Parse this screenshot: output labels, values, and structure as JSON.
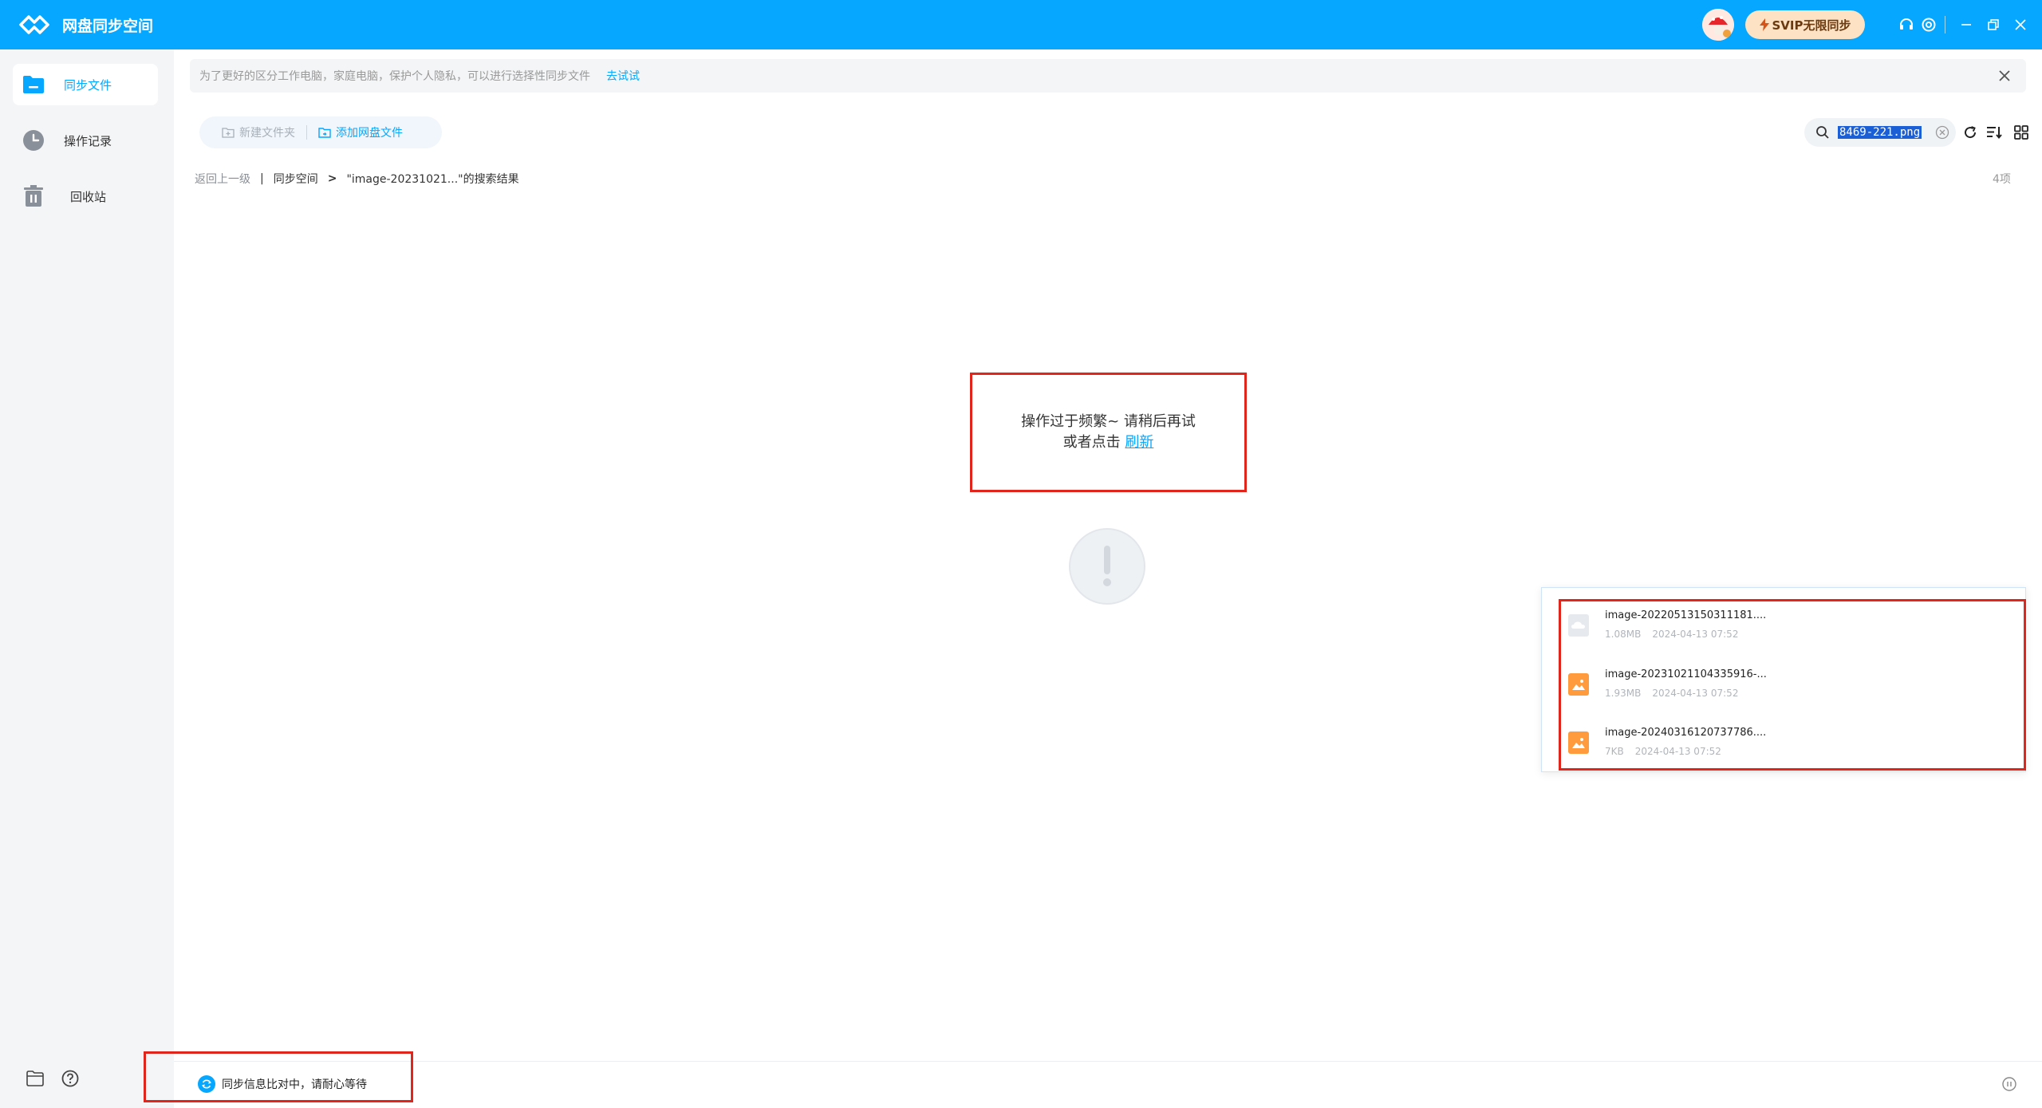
{
  "app": {
    "title": "网盘同步空间",
    "svip_label": "SVIP无限同步"
  },
  "sidebar": {
    "items": [
      {
        "label": "同步文件",
        "icon": "folder-icon",
        "active": true
      },
      {
        "label": "操作记录",
        "icon": "clock-icon",
        "active": false
      },
      {
        "label": "回收站",
        "icon": "trash-icon",
        "active": false
      }
    ]
  },
  "notice": {
    "text": "为了更好的区分工作电脑，家庭电脑，保护个人隐私，可以进行选择性同步文件",
    "link": "去试试"
  },
  "toolbar": {
    "new_folder": "新建文件夹",
    "add_files": "添加网盘文件"
  },
  "search": {
    "value": "8469-221.png"
  },
  "breadcrumb": {
    "back": "返回上一级",
    "root": "同步空间",
    "current": "\"image-20231021...\"的搜索结果"
  },
  "count": "4项",
  "error": {
    "line1": "操作过于频繁~ 请稍后再试",
    "line2_prefix": "或者点击",
    "refresh": "刷新"
  },
  "recent_files": [
    {
      "name": "image-20220513150311181....",
      "size": "1.08MB",
      "time": "2024-04-13 07:52",
      "icon": "cloud-file-icon"
    },
    {
      "name": "image-20231021104335916-...",
      "size": "1.93MB",
      "time": "2024-04-13 07:52",
      "icon": "image-file-icon"
    },
    {
      "name": "image-20240316120737786....",
      "size": "7KB",
      "time": "2024-04-13 07:52",
      "icon": "image-file-icon"
    }
  ],
  "status": {
    "text": "同步信息比对中，请耐心等待"
  },
  "colors": {
    "accent": "#06a7ff",
    "highlight_border": "#e0261c",
    "svip_bg": "#fde2c4"
  }
}
